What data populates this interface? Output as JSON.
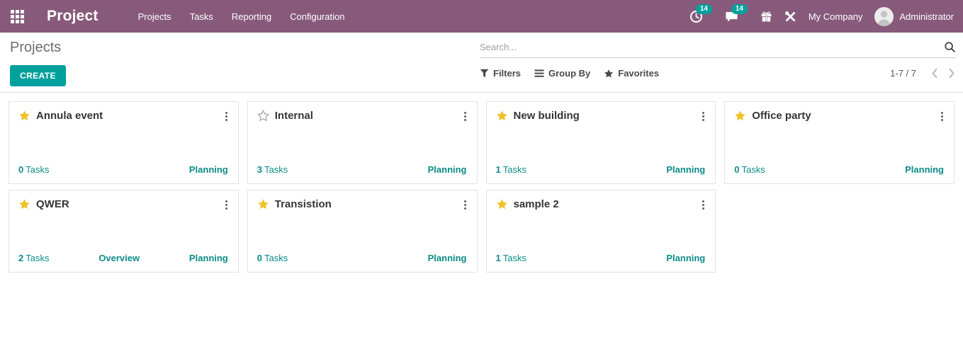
{
  "navbar": {
    "brand": "Project",
    "menu": [
      "Projects",
      "Tasks",
      "Reporting",
      "Configuration"
    ],
    "activity_count": "14",
    "message_count": "14",
    "company": "My Company",
    "user": "Administrator"
  },
  "control_panel": {
    "title": "Projects",
    "create_label": "CREATE",
    "search_placeholder": "Search...",
    "filters_label": "Filters",
    "group_by_label": "Group By",
    "favorites_label": "Favorites",
    "pager": "1-7 / 7"
  },
  "colors": {
    "navbar_background": "#875a7b",
    "accent_teal": "#00a09d",
    "link_teal": "#0c8c89",
    "favorite_star": "#efc228"
  },
  "icons": {
    "apps": "grid-icon",
    "activities": "clock-icon",
    "messages": "chat-bubble-icon",
    "gift": "gift-icon",
    "tools": "crossed-tools-icon",
    "search": "magnifier-icon",
    "filters": "funnel-icon",
    "group_by": "bars-icon",
    "favorites": "star-icon"
  },
  "cards": [
    {
      "title": "Annula event",
      "favorite": true,
      "tasks_count": "0",
      "tasks_label": "Tasks",
      "middle_link": "",
      "stage": "Planning"
    },
    {
      "title": "Internal",
      "favorite": false,
      "tasks_count": "3",
      "tasks_label": "Tasks",
      "middle_link": "",
      "stage": "Planning"
    },
    {
      "title": "New building",
      "favorite": true,
      "tasks_count": "1",
      "tasks_label": "Tasks",
      "middle_link": "",
      "stage": "Planning"
    },
    {
      "title": "Office party",
      "favorite": true,
      "tasks_count": "0",
      "tasks_label": "Tasks",
      "middle_link": "",
      "stage": "Planning"
    },
    {
      "title": "QWER",
      "favorite": true,
      "tasks_count": "2",
      "tasks_label": "Tasks",
      "middle_link": "Overview",
      "stage": "Planning"
    },
    {
      "title": "Transistion",
      "favorite": true,
      "tasks_count": "0",
      "tasks_label": "Tasks",
      "middle_link": "",
      "stage": "Planning"
    },
    {
      "title": "sample 2",
      "favorite": true,
      "tasks_count": "1",
      "tasks_label": "Tasks",
      "middle_link": "",
      "stage": "Planning"
    }
  ]
}
